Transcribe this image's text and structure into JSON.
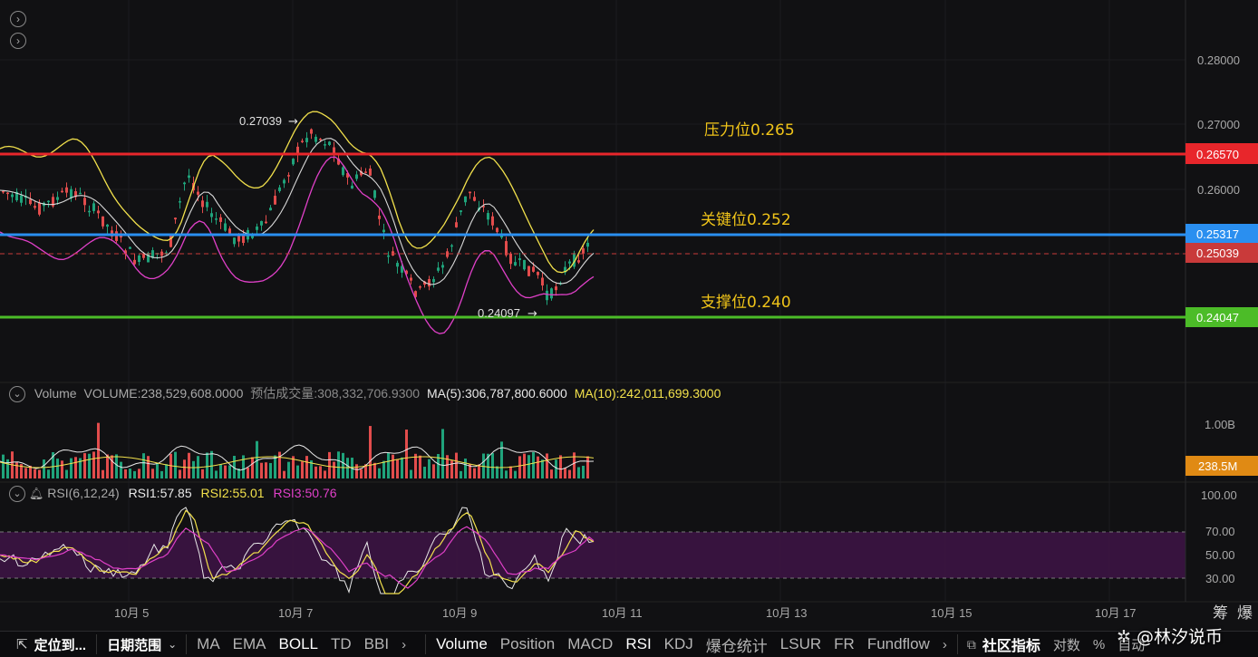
{
  "price_axis": {
    "ticks": [
      "0.28000",
      "0.27000",
      "0.26000"
    ],
    "tags": [
      {
        "value": "0.26570",
        "color": "#e8262b"
      },
      {
        "value": "0.25317",
        "color": "#2a8ff0"
      },
      {
        "value": "0.25039",
        "color": "#c93a3a"
      },
      {
        "value": "0.24047",
        "color": "#4cbc28"
      }
    ]
  },
  "annotations": {
    "resistance": "压力位0.265",
    "key": "关键位0.252",
    "support": "支撑位0.240",
    "high": "0.27039",
    "low": "0.24097"
  },
  "volume_panel": {
    "name": "Volume",
    "volume": "VOLUME:238,529,608.0000",
    "est": "预估成交量:308,332,706.9300",
    "ma5": "MA(5):306,787,800.6000",
    "ma10": "MA(10):242,011,699.3000",
    "axis_tick": "1.00B",
    "tag": "238.5M"
  },
  "rsi_panel": {
    "name": "RSI(6,12,24)",
    "rsi1": "RSI1:57.85",
    "rsi2": "RSI2:55.01",
    "rsi3": "RSI3:50.76",
    "axis_ticks": [
      "100.00",
      "70.00",
      "50.00",
      "30.00"
    ]
  },
  "time_axis": [
    "10月 5",
    "10月 7",
    "10月 9",
    "10月 11",
    "10月 13",
    "10月 15",
    "10月 17"
  ],
  "toolbar": {
    "locate": "定位到...",
    "date_range": "日期范围",
    "indicators_left": [
      "MA",
      "EMA",
      "BOLL",
      "TD",
      "BBI"
    ],
    "indicators_right": [
      "Volume",
      "Position",
      "MACD",
      "RSI",
      "KDJ",
      "爆仓统计",
      "LSUR",
      "FR",
      "Fundflow"
    ],
    "community": "社区指标",
    "right_items": [
      "对数",
      "%",
      "自动"
    ],
    "watermark": "@林汐说币",
    "corner_chars": [
      "筹",
      "爆"
    ]
  },
  "colors": {
    "up": "#1fa37b",
    "down": "#e24c4c",
    "boll_upper": "#f2e14c",
    "boll_mid": "#d9d9d9",
    "boll_lower": "#e040c8",
    "rsi1": "#e8e8e8",
    "rsi2": "#f2e14c",
    "rsi3": "#e040c8"
  }
}
